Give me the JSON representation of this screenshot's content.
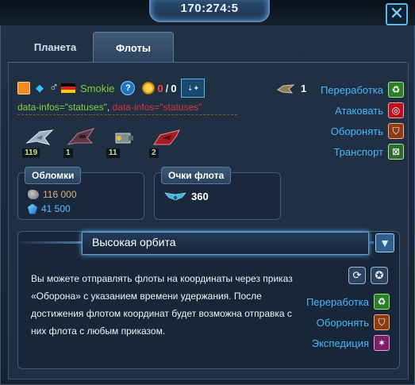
{
  "header": {
    "coords": "170:274:5",
    "close_label": "✕"
  },
  "tabs": [
    {
      "label": "Планета"
    },
    {
      "label": "Флоты"
    }
  ],
  "player": {
    "name": "Smokie",
    "help": "?",
    "count_red": "0",
    "count_sep": "/",
    "count_total": "0",
    "tech_label": "⇣✦"
  },
  "raw": {
    "part1": "data-infos=\"statuses\"",
    "comma": ", ",
    "part2": "data-infos=\"statuses\""
  },
  "ships": [
    {
      "count": "119",
      "color": "#aab7c4"
    },
    {
      "count": "1",
      "color": "#6b3b4a"
    },
    {
      "count": "11",
      "color": "#8fa7a0"
    },
    {
      "count": "2",
      "color": "#b3242c"
    }
  ],
  "probe": {
    "count": "1"
  },
  "actions_top": [
    {
      "label": "Переработка",
      "icon": "recycle-icon"
    },
    {
      "label": "Атаковать",
      "icon": "attack-icon"
    },
    {
      "label": "Оборонять",
      "icon": "shield-icon"
    },
    {
      "label": "Транспорт",
      "icon": "transport-icon"
    }
  ],
  "debris": {
    "title": "Обломки",
    "metal": "116 000",
    "crystal": "41 500"
  },
  "points": {
    "title": "Очки флота",
    "value": "360"
  },
  "orbit": {
    "title": "Высокая орбита",
    "text": "Вы можете отправлять флоты на координаты через приказ «Оборона» с указанием времени удержания. После достижения флотом координат будет возможна отправка с них флота с любым приказом."
  },
  "actions_orbit": [
    {
      "label": "Переработка",
      "icon": "recycle-icon"
    },
    {
      "label": "Оборонять",
      "icon": "shield-icon"
    },
    {
      "label": "Экспедиция",
      "icon": "expedition-icon"
    }
  ],
  "colors": {
    "accent": "#48b6ff",
    "name": "#7fcf39",
    "red": "#ff4444"
  }
}
